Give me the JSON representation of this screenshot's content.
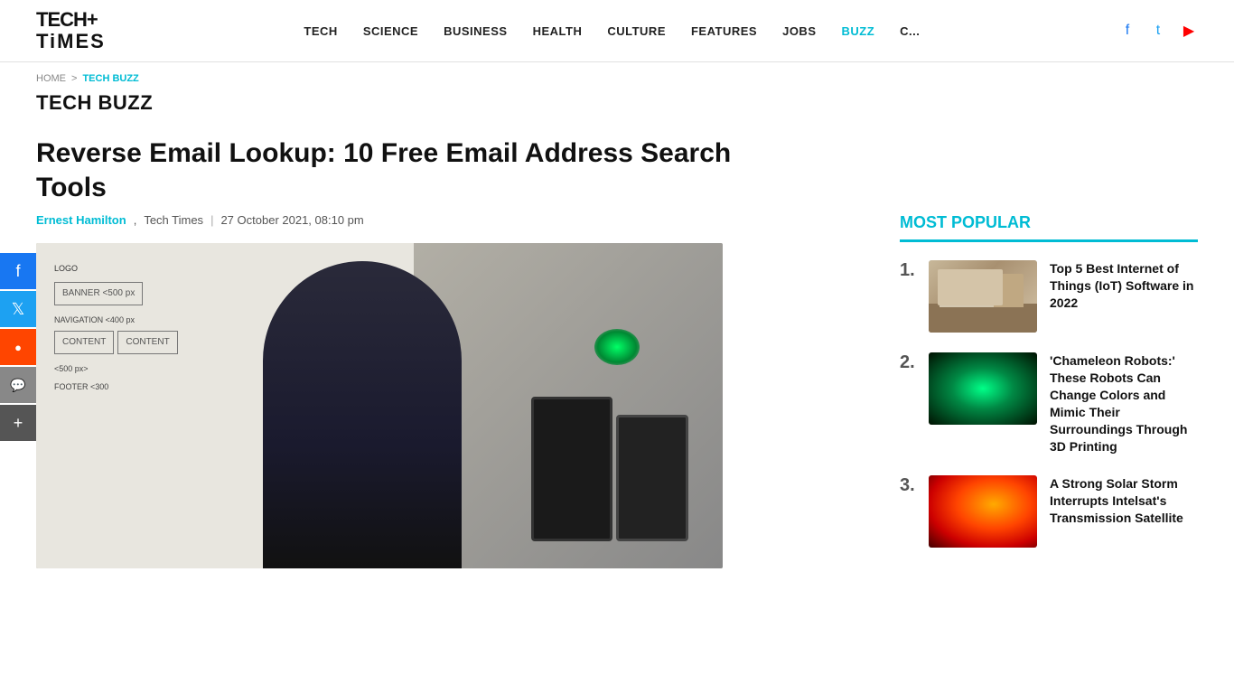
{
  "header": {
    "logo_line1": "TECH+",
    "logo_line2": "TiMES",
    "nav_items": [
      {
        "label": "TECH",
        "href": "#",
        "active": false
      },
      {
        "label": "SCIENCE",
        "href": "#",
        "active": false
      },
      {
        "label": "BUSINESS",
        "href": "#",
        "active": false
      },
      {
        "label": "HEALTH",
        "href": "#",
        "active": false
      },
      {
        "label": "CULTURE",
        "href": "#",
        "active": false
      },
      {
        "label": "FEATURES",
        "href": "#",
        "active": false
      },
      {
        "label": "JOBS",
        "href": "#",
        "active": false
      },
      {
        "label": "BUZZ",
        "href": "#",
        "active": true
      },
      {
        "label": "C...",
        "href": "#",
        "active": false
      }
    ]
  },
  "breadcrumb": {
    "home": "HOME",
    "separator": ">",
    "current": "TECH BUZZ"
  },
  "page_title": "TECH BUZZ",
  "article": {
    "title": "Reverse Email Lookup: 10 Free Email Address Search Tools",
    "author": "Ernest Hamilton",
    "source": "Tech Times",
    "date": "27 October 2021, 08:10 pm"
  },
  "social_sidebar": {
    "buttons": [
      {
        "icon": "f",
        "label": "facebook"
      },
      {
        "icon": "🐦",
        "label": "twitter"
      },
      {
        "icon": "reddit",
        "label": "reddit"
      },
      {
        "icon": "💬",
        "label": "message"
      },
      {
        "icon": "+",
        "label": "more"
      }
    ]
  },
  "sidebar": {
    "most_popular_title": "MOST POPULAR",
    "items": [
      {
        "num": "1.",
        "title": "Top 5 Best Internet of Things (IoT) Software in 2022",
        "thumb_type": "iot"
      },
      {
        "num": "2.",
        "title": "'Chameleon Robots:' These Robots Can Change Colors and Mimic Their Surroundings Through 3D Printing",
        "thumb_type": "chameleon"
      },
      {
        "num": "3.",
        "title": "A Strong Solar Storm Interrupts Intelsat's Transmission Satellite",
        "thumb_type": "solar"
      }
    ]
  },
  "colors": {
    "accent": "#00bcd4",
    "primary_text": "#111111",
    "secondary_text": "#555555",
    "link": "#1877f2",
    "twitter": "#1da1f2",
    "youtube": "#ff0000"
  }
}
